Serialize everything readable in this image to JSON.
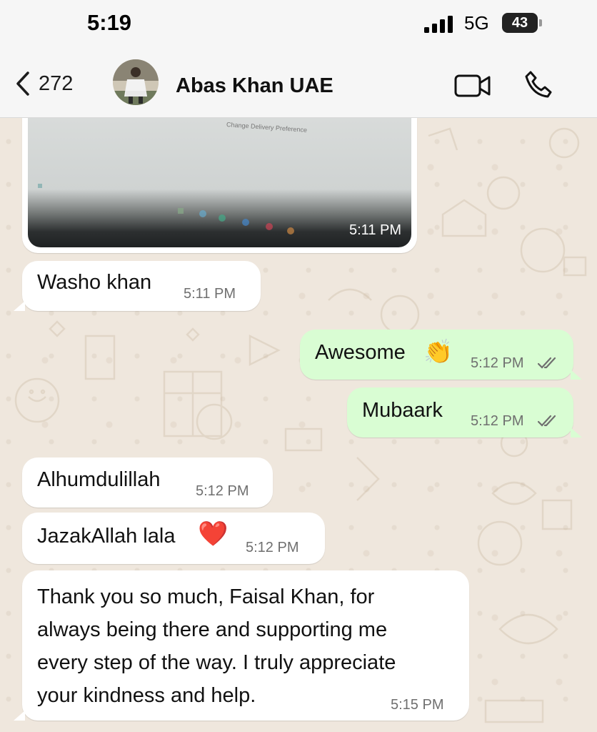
{
  "status_bar": {
    "time": "5:19",
    "network": "5G",
    "battery": "43"
  },
  "header": {
    "back_count": "272",
    "contact_name": "Abas Khan UAE",
    "icons": [
      "chevron-left-icon",
      "video-call-icon",
      "phone-icon"
    ]
  },
  "messages": [
    {
      "type": "image",
      "direction": "in",
      "caption_in_image": "Change Delivery Preference",
      "time": "5:11 PM"
    },
    {
      "type": "text",
      "direction": "in",
      "text": "Washo khan",
      "time": "5:11 PM"
    },
    {
      "type": "text",
      "direction": "out",
      "text": "Awesome",
      "emoji": "👏",
      "time": "5:12 PM",
      "status": "read"
    },
    {
      "type": "text",
      "direction": "out",
      "text": "Mubaark",
      "time": "5:12 PM",
      "status": "read"
    },
    {
      "type": "text",
      "direction": "in",
      "text": "Alhumdulillah",
      "time": "5:12 PM"
    },
    {
      "type": "text",
      "direction": "in",
      "text": "JazakAllah lala",
      "emoji": "❤️",
      "time": "5:12 PM"
    },
    {
      "type": "text",
      "direction": "in",
      "lines": [
        "Thank you so much, Faisal Khan, for",
        "always being there and supporting me",
        "every step of the way. I truly appreciate",
        "your kindness and help."
      ],
      "time": "5:15 PM"
    }
  ],
  "colors": {
    "incoming_bubble": "#ffffff",
    "outgoing_bubble": "#d9fdd3",
    "wallpaper": "#efe7dd",
    "header_bg": "#f6f6f6",
    "tick_color": "#6f6f6f"
  }
}
